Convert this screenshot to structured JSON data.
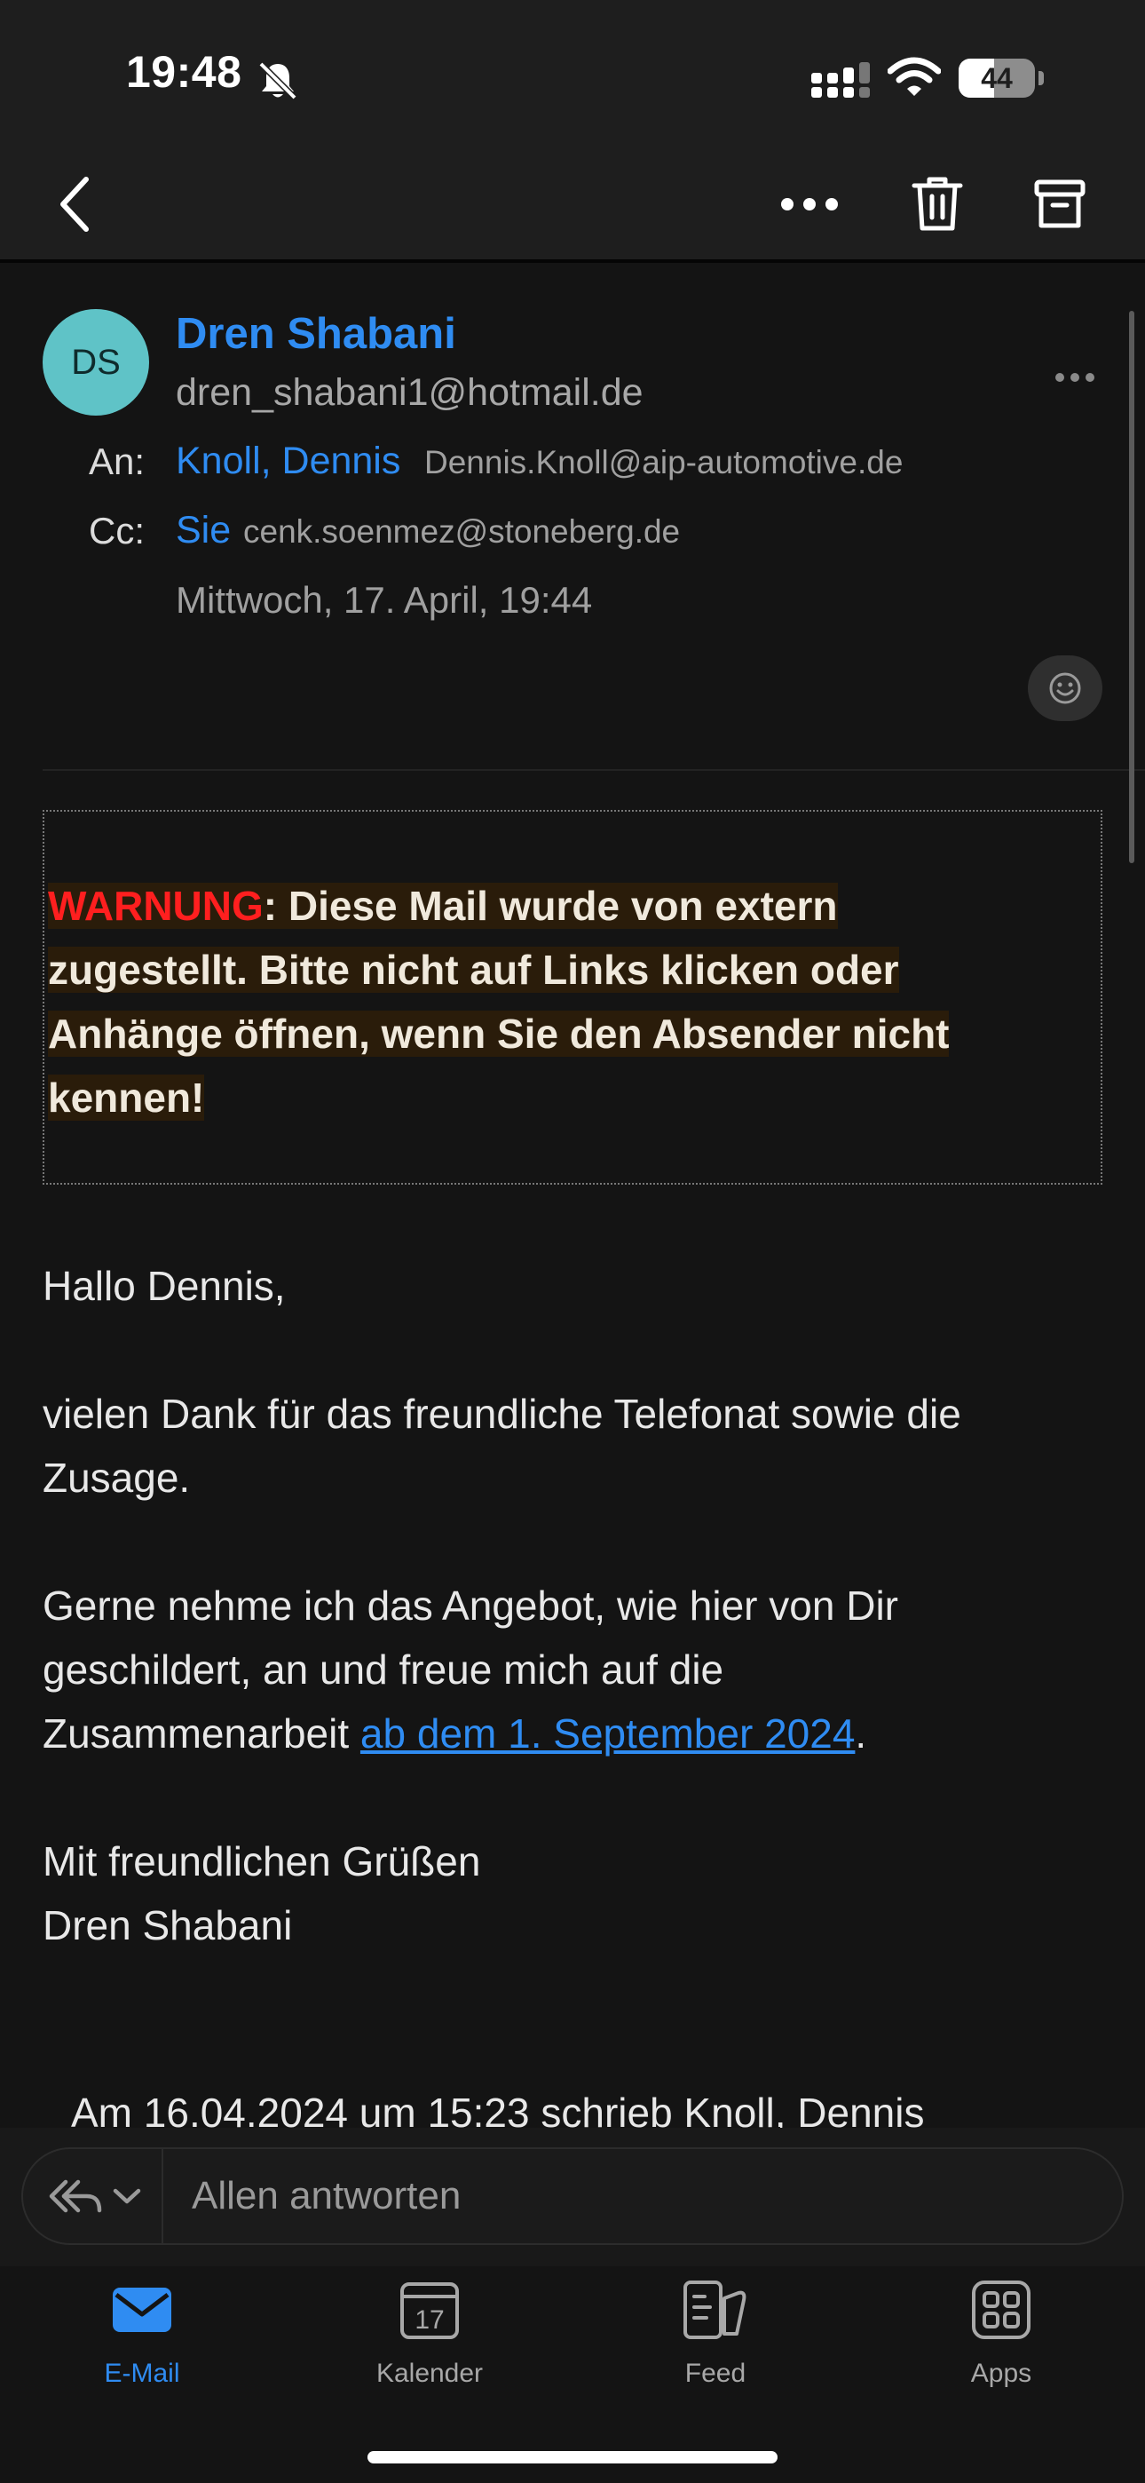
{
  "status_bar": {
    "time": "19:48",
    "battery": "44"
  },
  "email": {
    "avatar_initials": "DS",
    "sender_name": "Dren Shabani",
    "sender_email": "dren_shabani1@hotmail.de",
    "to_label": "An:",
    "to_name": "Knoll, Dennis",
    "to_email": "Dennis.Knoll@aip-automotive.de",
    "cc_label": "Cc:",
    "cc_name": "Sie",
    "cc_email": "cenk.soenmez@stoneberg.de",
    "date": "Mittwoch, 17. April, 19:44"
  },
  "warning": {
    "label": "WARNUNG",
    "lines": [
      ": Diese Mail wurde von extern",
      "zugestellt. Bitte nicht auf Links klicken oder",
      "Anhänge öffnen, wenn Sie den Absender nicht",
      "kennen!"
    ]
  },
  "body": {
    "greeting": "Hallo Dennis,",
    "para1": "vielen Dank für das freundliche Telefonat sowie die Zusage.",
    "para2_lines": [
      "Gerne nehme ich das Angebot, wie hier von Dir",
      "geschildert, an und freue mich auf die",
      "Zusammenarbeit "
    ],
    "para2_link": "ab dem 1. September 2024",
    "para2_end": ".",
    "closing": "Mit freundlichen Grüßen",
    "signature": "Dren Shabani",
    "quote_header": "Am 16.04.2024 um 15:23 schrieb Knoll, Dennis"
  },
  "reply": {
    "placeholder": "Allen antworten"
  },
  "tabs": [
    {
      "label": "E-Mail",
      "icon": "mail-icon",
      "active": true
    },
    {
      "label": "Kalender",
      "icon": "calendar-icon",
      "active": false,
      "day": "17"
    },
    {
      "label": "Feed",
      "icon": "feed-icon",
      "active": false
    },
    {
      "label": "Apps",
      "icon": "apps-icon",
      "active": false
    }
  ],
  "colors": {
    "accent": "#2f8cf2",
    "warning": "#ff1f1f",
    "avatar": "#5fc3c7",
    "background": "#141414"
  }
}
